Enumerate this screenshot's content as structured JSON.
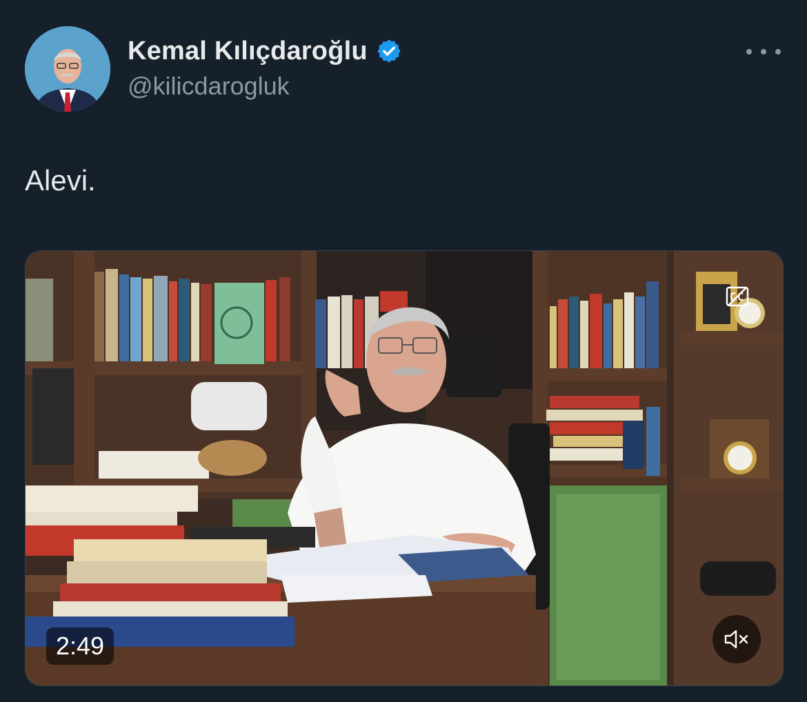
{
  "author": {
    "display_name": "Kemal Kılıçdaroğlu",
    "handle": "@kilicdarogluk",
    "verified": true,
    "verified_color": "#1d9bf0"
  },
  "tweet": {
    "text": "Alevi."
  },
  "media": {
    "type": "video",
    "duration": "2:49",
    "muted": true,
    "captions_available": true
  },
  "icons": {
    "more": "more-horizontal-icon",
    "verified": "verified-badge-icon",
    "mute": "volume-muted-icon",
    "captions": "closed-captions-icon"
  },
  "colors": {
    "background": "#15202b",
    "text_primary": "#e7e9ea",
    "text_secondary": "#8b98a5"
  }
}
